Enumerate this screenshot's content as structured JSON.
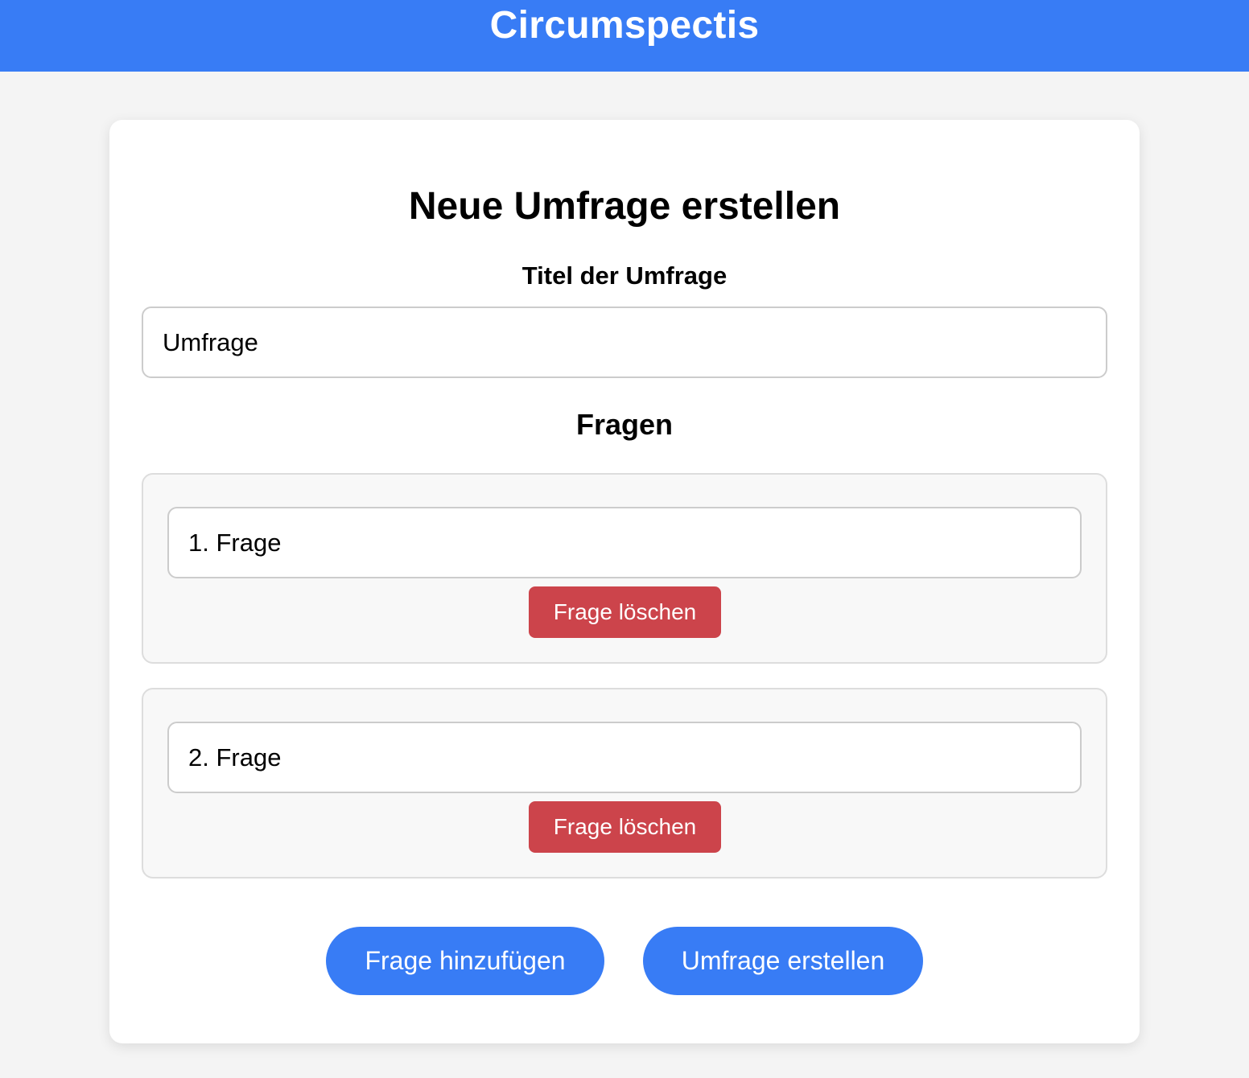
{
  "app": {
    "title": "Circumspectis"
  },
  "form": {
    "heading": "Neue Umfrage erstellen",
    "title_label": "Titel der Umfrage",
    "title_value": "Umfrage",
    "questions_heading": "Fragen",
    "questions": [
      {
        "value": "1. Frage",
        "delete_label": "Frage löschen"
      },
      {
        "value": "2. Frage",
        "delete_label": "Frage löschen"
      }
    ],
    "add_question_label": "Frage hinzufügen",
    "create_survey_label": "Umfrage erstellen"
  },
  "colors": {
    "header_bg": "#387cf5",
    "primary_button": "#387cf5",
    "danger_button": "#cc444b",
    "page_bg": "#f4f4f4"
  }
}
